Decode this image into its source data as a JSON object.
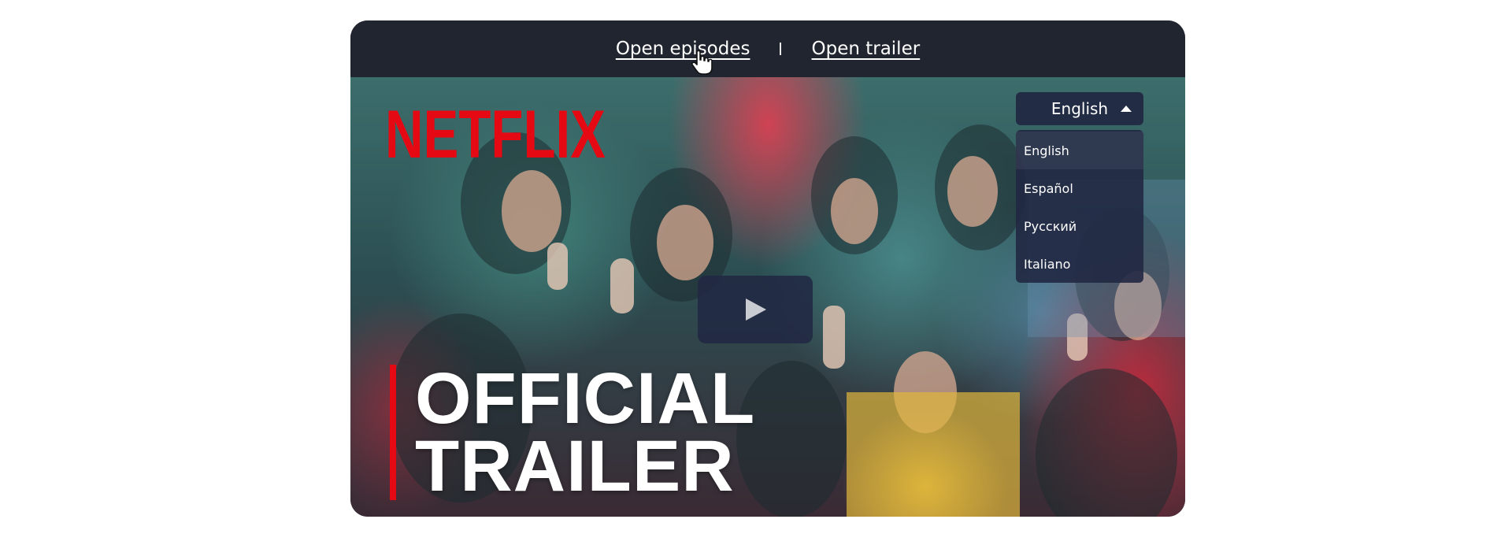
{
  "topbar": {
    "episodes_link": "Open episodes",
    "trailer_link": "Open trailer"
  },
  "video": {
    "brand": "NETFLIX",
    "title_line1": "OFFICIAL",
    "title_line2": "TRAILER"
  },
  "language": {
    "selected": "English",
    "options": [
      "English",
      "Español",
      "Русский",
      "Italiano"
    ]
  },
  "colors": {
    "bar_background": "#20252f",
    "brand_red": "#e50914",
    "overlay_navy": "#212842"
  },
  "icons": {
    "play": "play-icon",
    "caret": "caret-up-icon",
    "cursor": "hand-pointer-icon"
  }
}
